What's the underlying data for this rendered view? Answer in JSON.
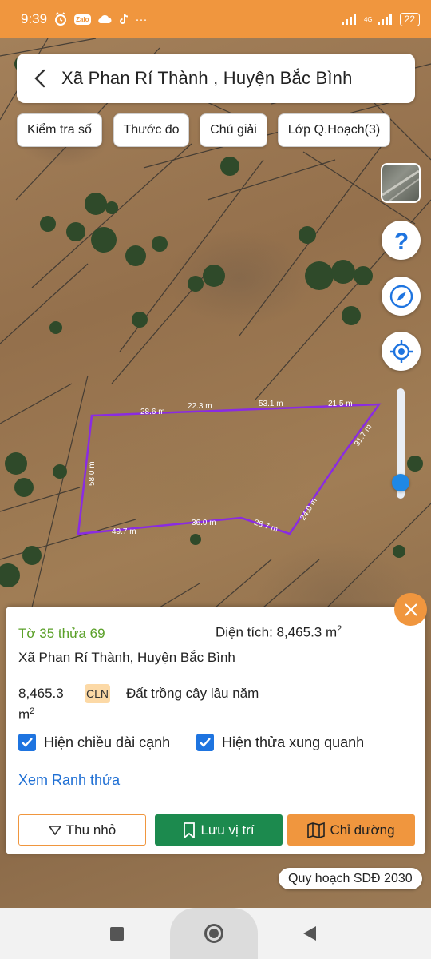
{
  "status_bar": {
    "time": "9:39",
    "zalo_label": "Zalo",
    "more": "···",
    "network": "4G",
    "battery": "22"
  },
  "header": {
    "title": "Xã Phan Rí Thành , Huyện Bắc Bình"
  },
  "chips": [
    "Kiểm tra số",
    "Thước đo",
    "Chú giải",
    "Lớp Q.Hoạch(3)"
  ],
  "map": {
    "parcel_color": "#8a2be2",
    "edge_labels": [
      "28.6 m",
      "22.3 m",
      "53.1 m",
      "21.5 m",
      "31.7 m",
      "24.0 m",
      "28.7 m",
      "36.0 m",
      "49.7 m",
      "58.0 m"
    ]
  },
  "controls": {
    "help_icon": "question-icon",
    "compass_icon": "compass-icon",
    "locate_icon": "locate-icon",
    "zoom_level": 0.9
  },
  "info": {
    "parcel_id": "Tờ 35 thửa 69",
    "area_prefix": "Diện tích: 8,465.3 m",
    "area_sup": "2",
    "address": "Xã Phan Rí Thành, Huyện Bắc Bình",
    "landuse_area": "8,465.3",
    "landuse_unit": "m",
    "landuse_unit_sup": "2",
    "landuse_code": "CLN",
    "landuse_name": "Đất trồng cây lâu năm",
    "check_edges": "Hiện chiều dài cạnh",
    "check_neighbors": "Hiện thửa xung quanh",
    "link_boundary": "Xem Ranh thửa",
    "btn_minimize": "Thu nhỏ",
    "btn_save": "Lưu vị trí",
    "btn_directions": "Chỉ đường"
  },
  "plan_label": "Quy hoạch SDĐ 2030",
  "colors": {
    "accent": "#f0963e",
    "green": "#1c8a4e",
    "blue": "#1e74e0",
    "parcel_id": "#5aa028"
  }
}
